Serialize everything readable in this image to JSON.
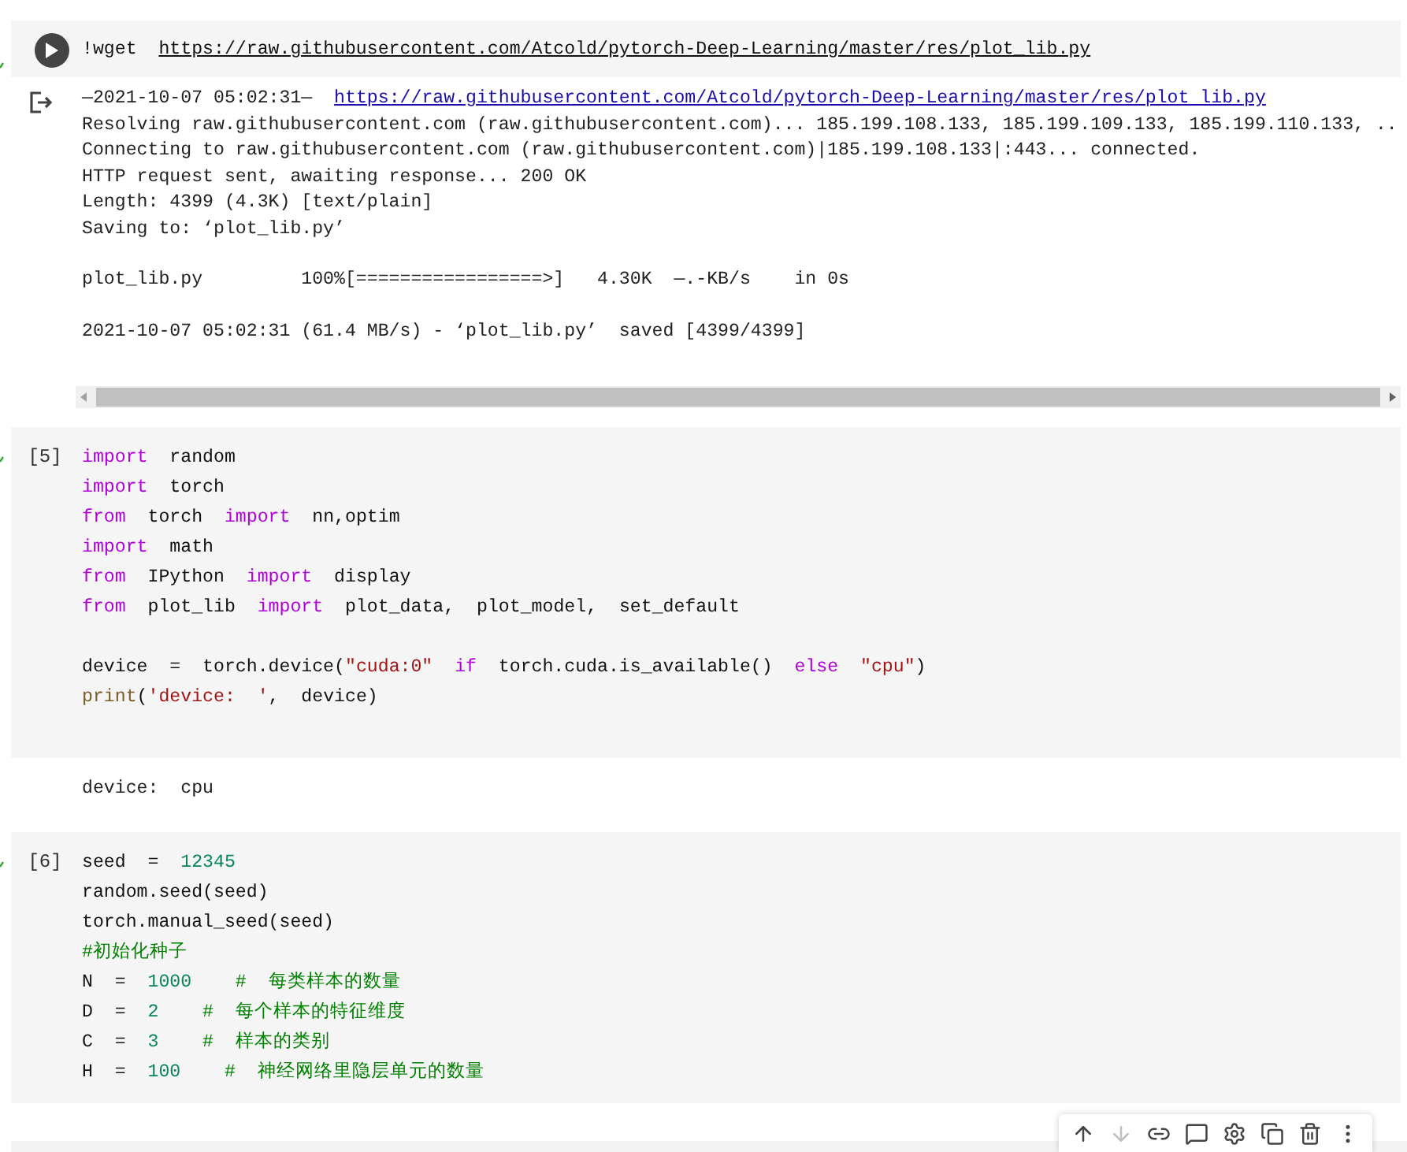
{
  "cells": [
    {
      "kind": "shell",
      "lines": [
        {
          "tokens": [
            {
              "kind": "plain",
              "text": "!wget  "
            },
            {
              "kind": "url",
              "text": "https://raw.githubusercontent.com/Atcold/pytorch-Deep-Learning/master/res/plot_lib.py"
            }
          ]
        }
      ],
      "output": {
        "kind": "log",
        "lines": [
          {
            "text": "—2021-10-07 05:02:31—  ",
            "link": "https://raw.githubusercontent.com/Atcold/pytorch-Deep-Learning/master/res/plot lib.py"
          },
          {
            "text": "Resolving raw.githubusercontent.com (raw.githubusercontent.com)... 185.199.108.133, 185.199.109.133, 185.199.110.133, .."
          },
          {
            "text": "Connecting to raw.githubusercontent.com (raw.githubusercontent.com)|185.199.108.133|:443... connected."
          },
          {
            "text": "HTTP request sent, awaiting response... 200 OK"
          },
          {
            "text": "Length: 4399 (4.3K) [text/plain]"
          },
          {
            "text": "Saving to: ‘plot_lib.py’"
          },
          {
            "text": "plot_lib.py         100%[=================>]   4.30K  —.-KB/s    in 0s",
            "spaced": true
          },
          {
            "text": "2021-10-07 05:02:31 (61.4 MB/s) - ‘plot_lib.py’  saved [4399/4399]",
            "spaced": true
          }
        ]
      }
    },
    {
      "kind": "code",
      "prompt": "[5]",
      "lines": [
        {
          "tokens": [
            {
              "kind": "keyword",
              "text": "import"
            },
            {
              "kind": "plain",
              "text": "  random"
            }
          ]
        },
        {
          "tokens": [
            {
              "kind": "keyword",
              "text": "import"
            },
            {
              "kind": "plain",
              "text": "  torch"
            }
          ]
        },
        {
          "tokens": [
            {
              "kind": "keyword",
              "text": "from"
            },
            {
              "kind": "plain",
              "text": "  torch  "
            },
            {
              "kind": "keyword",
              "text": "import"
            },
            {
              "kind": "plain",
              "text": "  nn,optim"
            }
          ]
        },
        {
          "tokens": [
            {
              "kind": "keyword",
              "text": "import"
            },
            {
              "kind": "plain",
              "text": "  math"
            }
          ]
        },
        {
          "tokens": [
            {
              "kind": "keyword",
              "text": "from"
            },
            {
              "kind": "plain",
              "text": "  IPython  "
            },
            {
              "kind": "keyword",
              "text": "import"
            },
            {
              "kind": "plain",
              "text": "  display"
            }
          ]
        },
        {
          "tokens": [
            {
              "kind": "keyword",
              "text": "from"
            },
            {
              "kind": "plain",
              "text": "  plot_lib  "
            },
            {
              "kind": "keyword",
              "text": "import"
            },
            {
              "kind": "plain",
              "text": "  plot_data,  plot_model,  set_default"
            }
          ]
        },
        {
          "spaced": true,
          "tokens": [
            {
              "kind": "plain",
              "text": "device  =  torch.device("
            },
            {
              "kind": "string",
              "text": "″cuda:0″  "
            },
            {
              "kind": "keyword",
              "text": "if"
            },
            {
              "kind": "plain",
              "text": "  torch.cuda.is_available()  "
            },
            {
              "kind": "keyword",
              "text": "else"
            },
            {
              "kind": "string",
              "text": "  ″cpu″"
            },
            {
              "kind": "plain",
              "text": ")"
            }
          ]
        },
        {
          "tokens": [
            {
              "kind": "builtin",
              "text": "print"
            },
            {
              "kind": "plain",
              "text": "("
            },
            {
              "kind": "string",
              "text": "'device:  '"
            },
            {
              "kind": "plain",
              "text": ",  device)"
            }
          ]
        }
      ],
      "output": {
        "kind": "plain",
        "lines": [
          {
            "text": "device:  cpu"
          }
        ]
      }
    },
    {
      "kind": "code",
      "prompt": "[6]",
      "lines": [
        {
          "tokens": [
            {
              "kind": "plain",
              "text": "seed  =  "
            },
            {
              "kind": "number",
              "text": "12345"
            }
          ]
        },
        {
          "tokens": [
            {
              "kind": "plain",
              "text": "random.seed(seed)"
            }
          ]
        },
        {
          "tokens": [
            {
              "kind": "plain",
              "text": "torch.manual_seed(seed)"
            }
          ]
        },
        {
          "tokens": [
            {
              "kind": "comment",
              "text": "#初始化种子"
            }
          ]
        },
        {
          "tokens": [
            {
              "kind": "plain",
              "text": "N  =  "
            },
            {
              "kind": "number",
              "text": "1000"
            },
            {
              "kind": "comment",
              "text": "    #  每类样本的数量"
            }
          ]
        },
        {
          "tokens": [
            {
              "kind": "plain",
              "text": "D  =  "
            },
            {
              "kind": "number",
              "text": "2"
            },
            {
              "kind": "comment",
              "text": "    #  每个样本的特征维度"
            }
          ]
        },
        {
          "tokens": [
            {
              "kind": "plain",
              "text": "C  =  "
            },
            {
              "kind": "number",
              "text": "3"
            },
            {
              "kind": "comment",
              "text": "    #  样本的类别"
            }
          ]
        },
        {
          "tokens": [
            {
              "kind": "plain",
              "text": "H  =  "
            },
            {
              "kind": "number",
              "text": "100"
            },
            {
              "kind": "comment",
              "text": "    #  神经网络里隐层单元的数量"
            }
          ]
        }
      ]
    }
  ],
  "cell_toolbar": [
    {
      "kind": "up",
      "disabled": false
    },
    {
      "kind": "down",
      "disabled": true
    },
    {
      "kind": "link",
      "disabled": false
    },
    {
      "kind": "comment",
      "disabled": false
    },
    {
      "kind": "settings",
      "disabled": false
    },
    {
      "kind": "mirror",
      "disabled": false
    },
    {
      "kind": "delete",
      "disabled": false
    },
    {
      "kind": "more",
      "disabled": false
    }
  ]
}
